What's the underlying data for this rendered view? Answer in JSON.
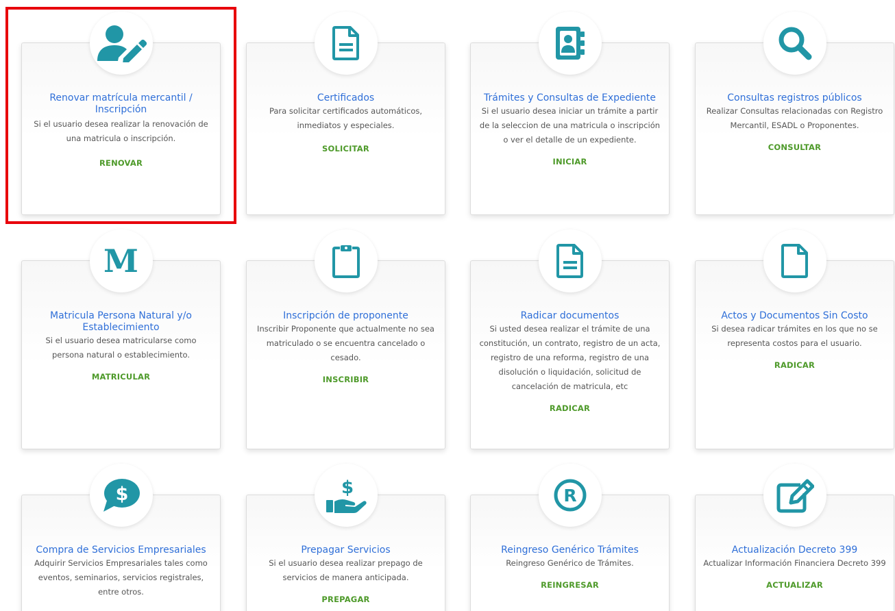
{
  "colors": {
    "icon": "#2196a6",
    "title": "#2f6fd8",
    "action": "#4e9a2a",
    "highlight": "#e8000b"
  },
  "cards": [
    {
      "icon": "user-edit-icon",
      "title": "Renovar matrícula mercantil / Inscripción",
      "description": "Si el usuario desea realizar la renovación de una matricula o inscripción.",
      "action": "RENOVAR"
    },
    {
      "icon": "file-text-icon",
      "title": "Certificados",
      "description": "Para solicitar certificados automáticos, inmediatos y especiales.",
      "action": "SOLICITAR"
    },
    {
      "icon": "address-book-icon",
      "title": "Trámites y Consultas de Expediente",
      "description": "Si el usuario desea iniciar un trámite a partir de la seleccion de una matricula o inscripción o ver el detalle de un expediente.",
      "action": "INICIAR"
    },
    {
      "icon": "search-icon",
      "title": "Consultas registros públicos",
      "description": "Realizar Consultas relacionadas con Registro Mercantil, ESADL o Proponentes.",
      "action": "CONSULTAR"
    },
    {
      "icon": "letter-m-icon",
      "icon_text": "M",
      "title": "Matricula Persona Natural y/o Establecimiento",
      "description": "Si el usuario desea matricularse como persona natural o establecimiento.",
      "action": "MATRICULAR"
    },
    {
      "icon": "clipboard-icon",
      "title": "Inscripción de proponente",
      "description": "Inscribir Proponente que actualmente no sea matriculado o se encuentra cancelado o cesado.",
      "action": "INSCRIBIR"
    },
    {
      "icon": "file-text-icon",
      "title": "Radicar documentos",
      "description": "Si usted desea realizar el trámite de una constitución, un contrato, registro de un acta, registro de una reforma, registro de una disolución o liquidación, solicitud de cancelación de matricula, etc",
      "action": "RADICAR"
    },
    {
      "icon": "blank-file-icon",
      "title": "Actos y Documentos Sin Costo",
      "description": "Si desea radicar trámites en los que no se representa costos para el usuario.",
      "action": "RADICAR"
    },
    {
      "icon": "dollar-speech-bubble-icon",
      "title": "Compra de Servicios Empresariales",
      "description": "Adquirir Servicios Empresariales tales como eventos, seminarios, servicios registrales, entre otros.",
      "action": ""
    },
    {
      "icon": "hand-dollar-icon",
      "title": "Prepagar Servicios",
      "description": "Si el usuario desea realizar prepago de servicios de manera anticipada.",
      "action": "PREPAGAR"
    },
    {
      "icon": "registered-icon",
      "title": "Reingreso Genérico Trámites",
      "description": "Reingreso Genérico de Trámites.",
      "action": "REINGRESAR"
    },
    {
      "icon": "edit-square-icon",
      "title": "Actualización Decreto 399",
      "description": "Actualizar Información Financiera Decreto 399",
      "action": "ACTUALIZAR"
    }
  ]
}
